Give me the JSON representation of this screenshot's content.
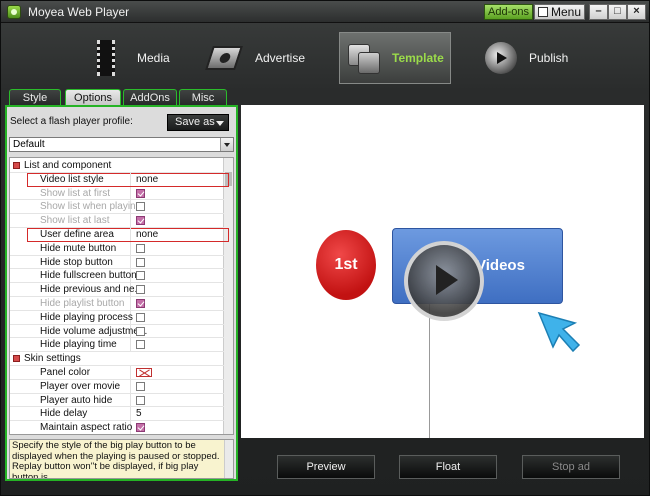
{
  "window": {
    "title": "Moyea Web Player",
    "addons_label": "Add-ons",
    "menu_label": "Menu",
    "minimize": "–",
    "maximize": "□",
    "close": "×"
  },
  "toolbar": {
    "items": [
      {
        "label": "Media",
        "icon": "film-icon",
        "active": false
      },
      {
        "label": "Advertise",
        "icon": "reel-icon",
        "active": false
      },
      {
        "label": "Template",
        "icon": "template-icon",
        "active": true
      },
      {
        "label": "Publish",
        "icon": "publish-icon",
        "active": false
      }
    ]
  },
  "tabs": [
    "Style",
    "Options",
    "AddOns",
    "Misc"
  ],
  "active_tab": "Options",
  "profile": {
    "label": "Select a flash player profile:",
    "save_as": "Save as",
    "selected": "Default"
  },
  "grid": {
    "rows": [
      {
        "type": "category",
        "label": "List and component"
      },
      {
        "type": "text",
        "label": "Video list style",
        "value": "none",
        "highlight": true
      },
      {
        "type": "check",
        "label": "Show list at first",
        "checked": true,
        "disabled": true
      },
      {
        "type": "check",
        "label": "Show list when playing",
        "checked": false,
        "disabled": true
      },
      {
        "type": "check",
        "label": "Show list at last",
        "checked": true,
        "disabled": true
      },
      {
        "type": "text",
        "label": "User define area",
        "value": "none",
        "highlight": true
      },
      {
        "type": "check",
        "label": "Hide mute button",
        "checked": false
      },
      {
        "type": "check",
        "label": "Hide stop button",
        "checked": false
      },
      {
        "type": "check",
        "label": "Hide fullscreen button",
        "checked": false
      },
      {
        "type": "check",
        "label": "Hide previous and ne...",
        "checked": false
      },
      {
        "type": "check",
        "label": "Hide playlist button",
        "checked": true,
        "disabled": true
      },
      {
        "type": "check",
        "label": "Hide playing process ...",
        "checked": false
      },
      {
        "type": "check",
        "label": "Hide volume adjustme...",
        "checked": false
      },
      {
        "type": "check",
        "label": "Hide playing time",
        "checked": false
      },
      {
        "type": "category",
        "label": "Skin settings"
      },
      {
        "type": "color",
        "label": "Panel color"
      },
      {
        "type": "check",
        "label": "Player over movie",
        "checked": false
      },
      {
        "type": "check",
        "label": "Player auto hide",
        "checked": false
      },
      {
        "type": "text",
        "label": "Hide delay",
        "value": "5"
      },
      {
        "type": "check",
        "label": "Maintain aspect ratio",
        "checked": true
      }
    ]
  },
  "description": "Specify the style of the big play button to be displayed when the playing is paused or stopped.\nReplay button won''t be displayed, if big play button is",
  "preview": {
    "badge": "1st",
    "videos_label": "Videos"
  },
  "buttons": {
    "preview": "Preview",
    "float": "Float",
    "stop_ad": "Stop ad"
  },
  "colors": {
    "accent": "#25b325",
    "active_tool": "#9bdc4a",
    "highlight_border": "#d42a2a"
  }
}
